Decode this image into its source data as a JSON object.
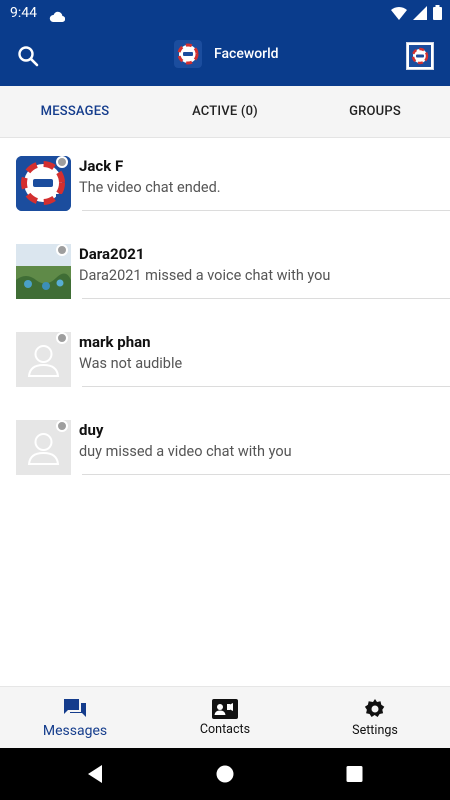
{
  "status_bar": {
    "time": "9:44"
  },
  "app_bar": {
    "title": "Faceworld"
  },
  "tabs": [
    {
      "label": "MESSAGES",
      "active": true
    },
    {
      "label": "ACTIVE (0)",
      "active": false
    },
    {
      "label": "GROUPS",
      "active": false
    }
  ],
  "conversations": [
    {
      "name": "Jack F",
      "preview": "The video chat ended.",
      "avatar": "faceworld-logo",
      "presence": "offline"
    },
    {
      "name": "Dara2021",
      "preview": "Dara2021 missed a voice chat with you",
      "avatar": "photo",
      "presence": "offline"
    },
    {
      "name": "mark phan",
      "preview": "Was not audible",
      "avatar": "placeholder",
      "presence": "offline"
    },
    {
      "name": "duy",
      "preview": "duy missed a video chat with you",
      "avatar": "placeholder",
      "presence": "offline"
    }
  ],
  "bottom_nav": [
    {
      "label": "Messages",
      "icon": "chat-bubbles-icon",
      "active": true
    },
    {
      "label": "Contacts",
      "icon": "contact-card-icon",
      "active": false
    },
    {
      "label": "Settings",
      "icon": "gear-icon",
      "active": false
    }
  ],
  "colors": {
    "primary": "#0a3c8c",
    "accent_text": "#143c8c",
    "presence_offline": "#9e9e9e"
  }
}
